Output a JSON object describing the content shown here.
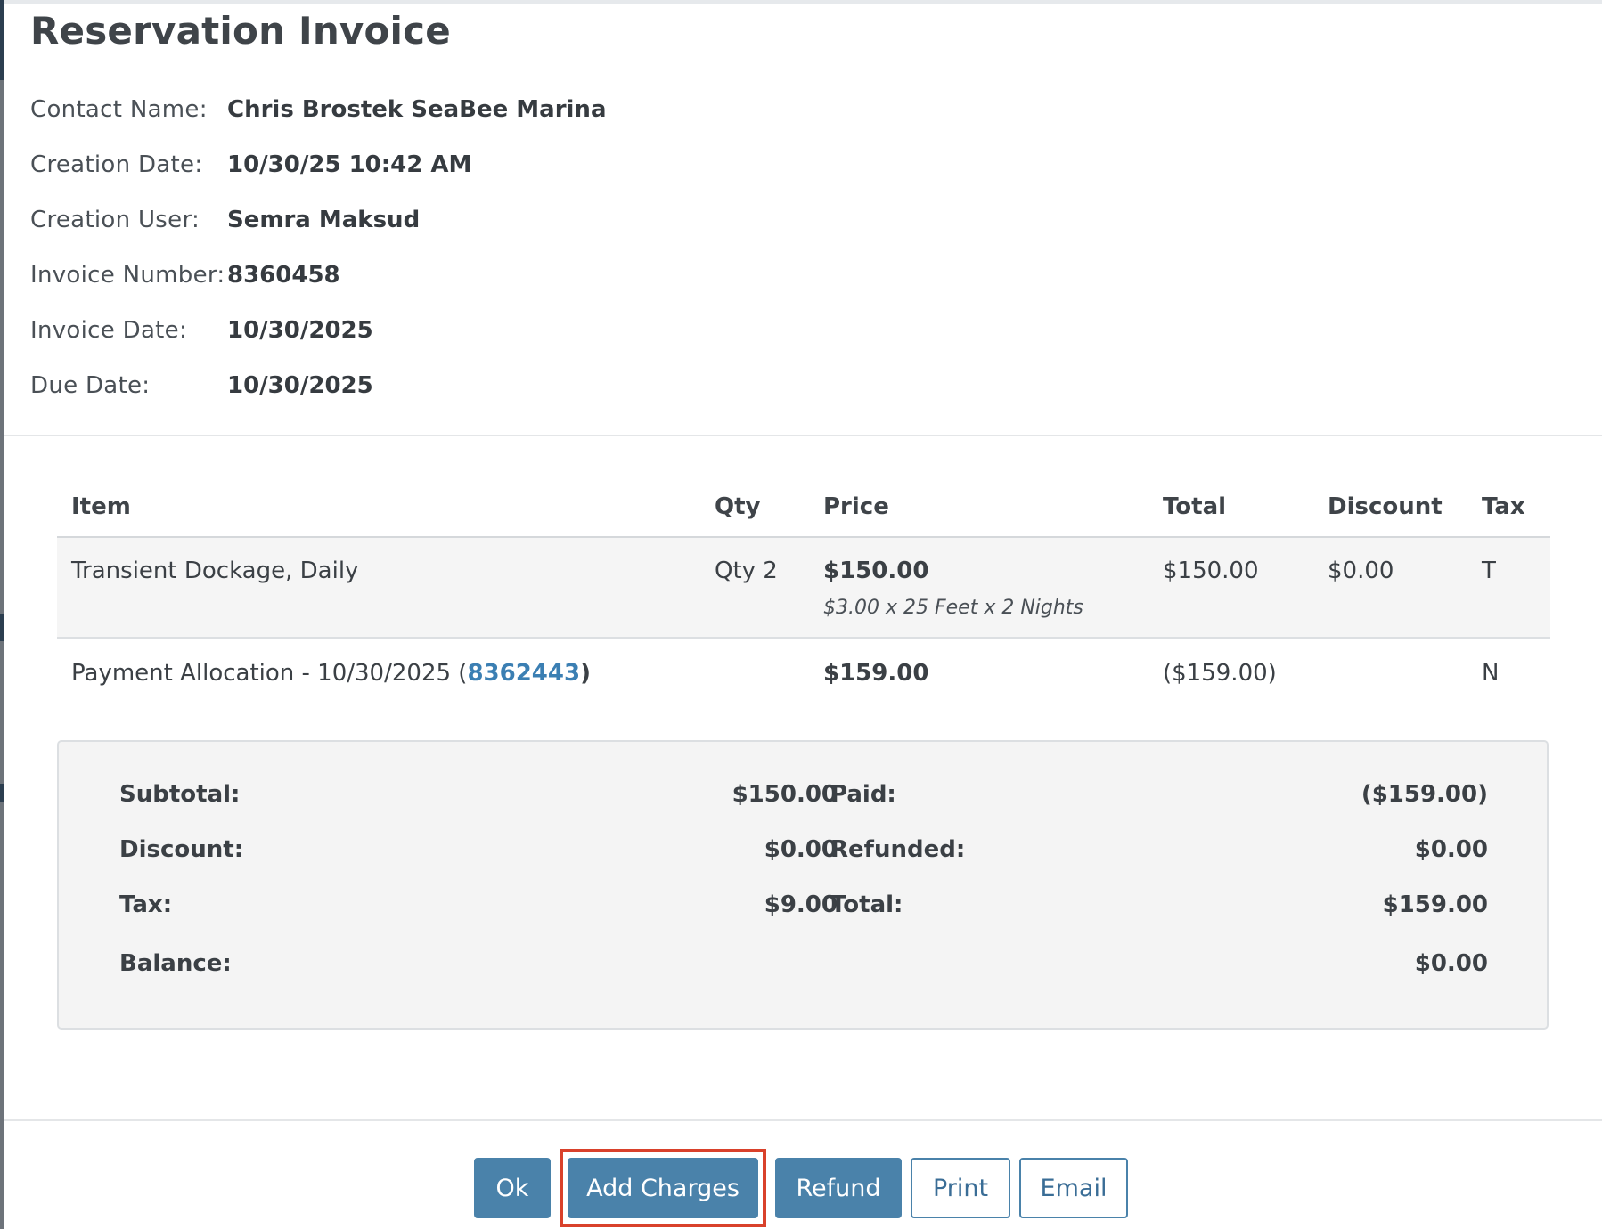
{
  "dialog": {
    "title": "Reservation Invoice"
  },
  "info": [
    {
      "label": "Contact Name:",
      "value": "Chris Brostek SeaBee Marina"
    },
    {
      "label": "Creation Date:",
      "value": "10/30/25 10:42 AM"
    },
    {
      "label": "Creation User:",
      "value": "Semra Maksud"
    },
    {
      "label": "Invoice Number:",
      "value": "8360458"
    },
    {
      "label": "Invoice Date:",
      "value": "10/30/2025"
    },
    {
      "label": "Due Date:",
      "value": "10/30/2025"
    }
  ],
  "table": {
    "headers": [
      "Item",
      "Qty",
      "Price",
      "Total",
      "Discount",
      "Tax"
    ],
    "rows": [
      {
        "item": "Transient Dockage, Daily",
        "qty": "Qty 2",
        "price": "$150.00",
        "price_detail": "$3.00 x 25 Feet x 2 Nights",
        "total": "$150.00",
        "discount": "$0.00",
        "tax": "T"
      },
      {
        "item_prefix": "Payment Allocation - 10/30/2025 (",
        "item_link": "8362443",
        "item_suffix": ")",
        "qty": "",
        "price": "$159.00",
        "total": "($159.00)",
        "discount": "",
        "tax": "N"
      }
    ]
  },
  "summary": {
    "subtotal_label": "Subtotal:",
    "subtotal": "$150.00",
    "discount_label": "Discount:",
    "discount": "$0.00",
    "tax_label": "Tax:",
    "tax": "$9.00",
    "balance_label": "Balance:",
    "balance": "$0.00",
    "paid_label": "Paid:",
    "paid": "($159.00)",
    "refunded_label": "Refunded:",
    "refunded": "$0.00",
    "total_label": "Total:",
    "total": "$159.00"
  },
  "buttons": {
    "ok": "Ok",
    "add_charges": "Add Charges",
    "refund": "Refund",
    "print": "Print",
    "email": "Email"
  },
  "colors": {
    "primary": "#4a82aa",
    "highlight": "#d9412b",
    "link": "#3b7fb3"
  }
}
